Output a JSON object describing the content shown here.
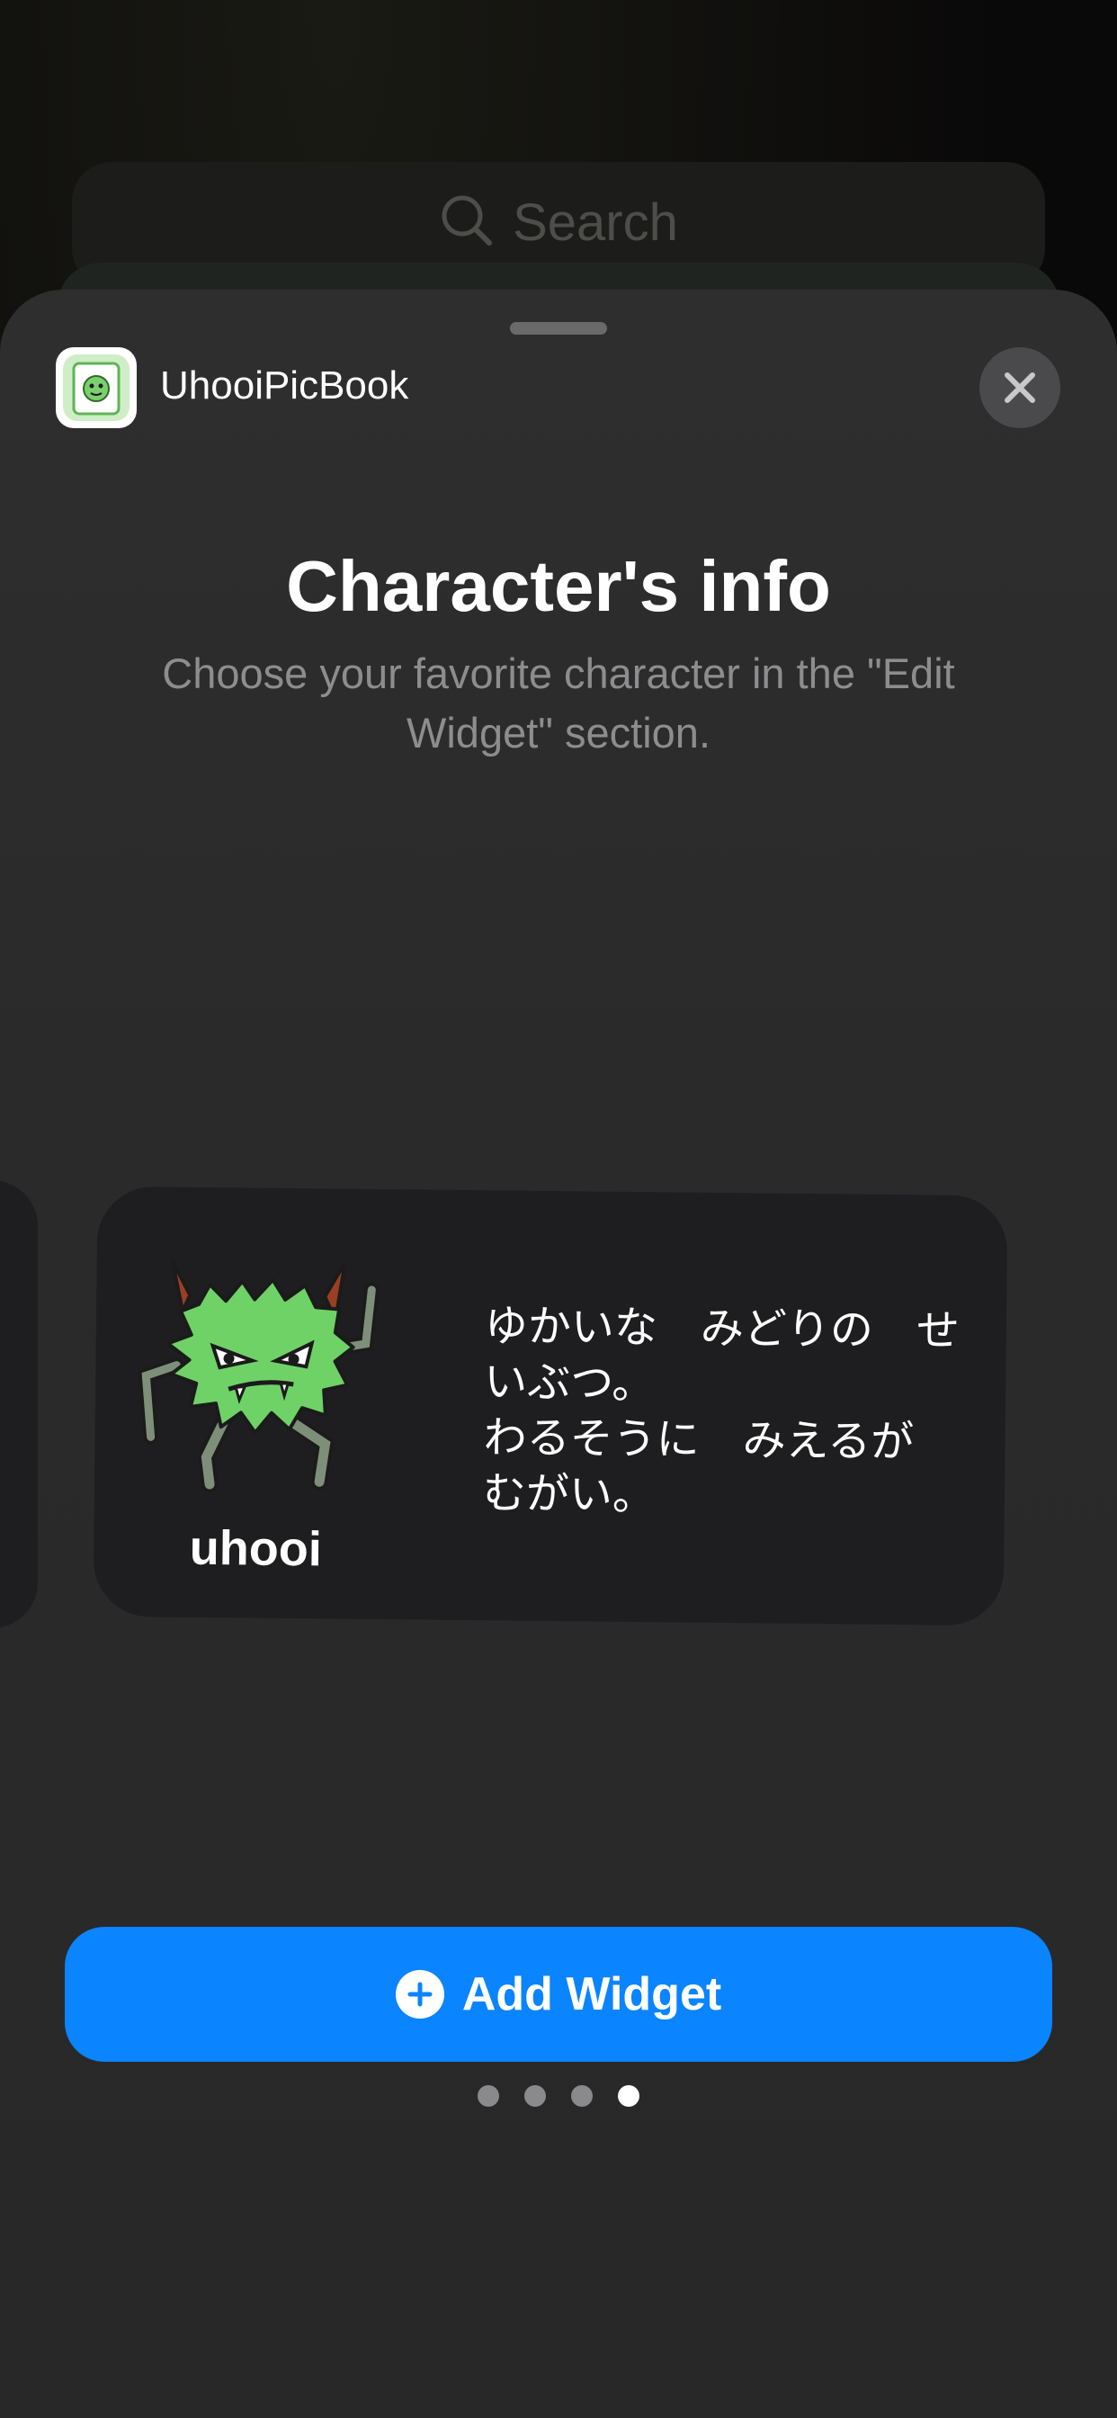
{
  "background": {
    "search_placeholder": "Search"
  },
  "sheet": {
    "app_name": "UhooiPicBook",
    "title": "Character's info",
    "subtitle": "Choose your favorite character in the \"Edit Widget\" section."
  },
  "widget": {
    "character_name": "uhooi",
    "description": "ゆかいな　みどりの　せいぶつ。\nわるそうに　みえるが　むがい。"
  },
  "pagination": {
    "count": 4,
    "active_index": 3
  },
  "add_button": {
    "label": "Add Widget"
  },
  "colors": {
    "accent": "#0a84ff",
    "sheet_background": "#2e2e2e",
    "widget_background": "#1e1e20"
  }
}
